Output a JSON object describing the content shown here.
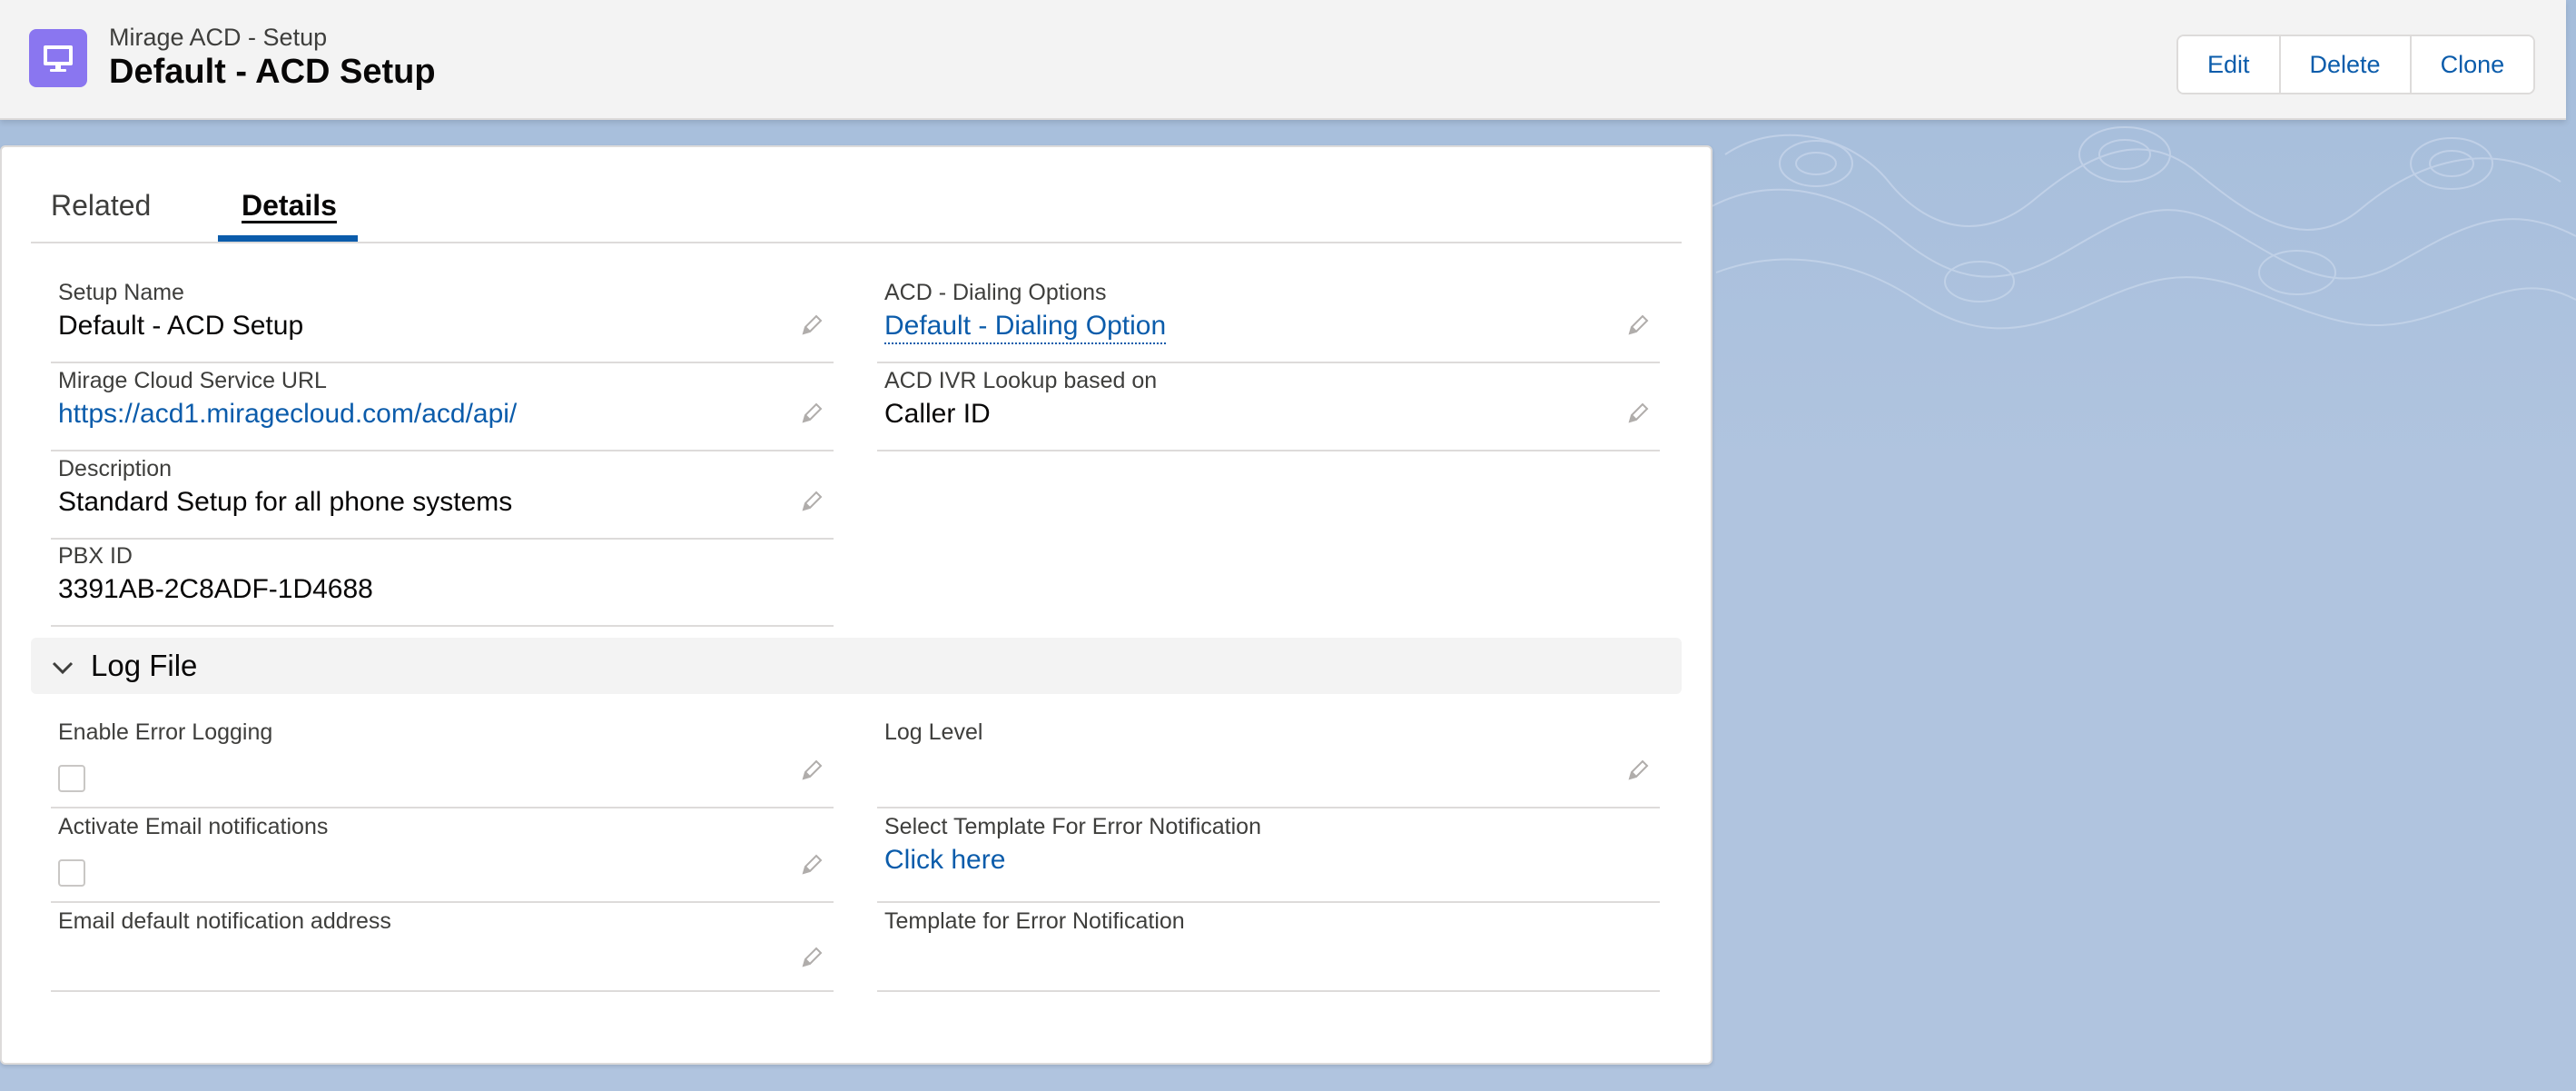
{
  "header": {
    "app_name": "Mirage ACD - Setup",
    "record_title": "Default - ACD Setup",
    "icon": "desktop-icon",
    "accent_color": "#8a76f0",
    "actions": [
      "Edit",
      "Delete",
      "Clone"
    ]
  },
  "tabs": [
    {
      "label": "Related",
      "active": false
    },
    {
      "label": "Details",
      "active": true
    }
  ],
  "details": {
    "setup_name": {
      "label": "Setup Name",
      "value": "Default - ACD Setup"
    },
    "service_url": {
      "label": "Mirage Cloud Service URL",
      "value": "https://acd1.miragecloud.com/acd/api/"
    },
    "description": {
      "label": "Description",
      "value": "Standard Setup for all phone systems"
    },
    "pbx_id": {
      "label": "PBX ID",
      "value": "3391AB-2C8ADF-1D4688"
    },
    "dialing_options": {
      "label": "ACD - Dialing Options",
      "value": "Default - Dialing Option"
    },
    "ivr_lookup": {
      "label": "ACD IVR Lookup based on",
      "value": "Caller ID"
    }
  },
  "log_section": {
    "title": "Log File",
    "enable_error_logging": {
      "label": "Enable Error Logging",
      "checked": false
    },
    "activate_email": {
      "label": "Activate Email notifications",
      "checked": false
    },
    "email_default": {
      "label": "Email default notification address",
      "value": ""
    },
    "log_level": {
      "label": "Log Level",
      "value": ""
    },
    "select_template": {
      "label": "Select Template For Error Notification",
      "value": "Click here"
    },
    "template_error": {
      "label": "Template for Error Notification",
      "value": ""
    }
  },
  "colors": {
    "link": "#0b5cab",
    "background": "#b0c4df"
  }
}
